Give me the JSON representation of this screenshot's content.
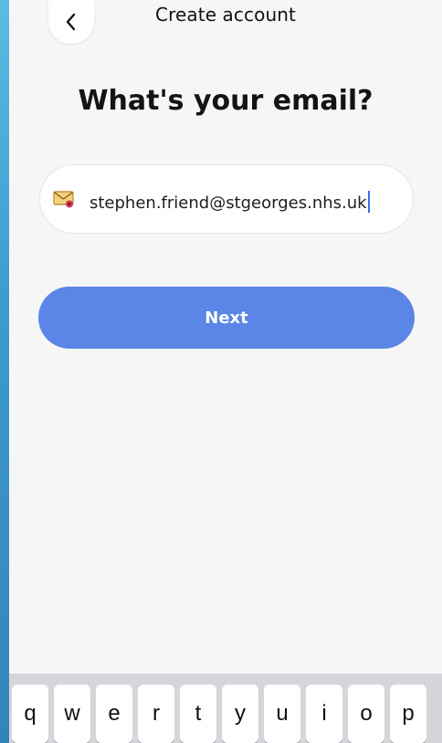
{
  "header": {
    "title": "Create account",
    "back_icon": "chevron-left-icon"
  },
  "main": {
    "headline": "What's your email?",
    "email_field": {
      "value": "stephen.friend@stgeorges.nhs.uk",
      "icon": "envelope-icon"
    },
    "next_button": {
      "label": "Next"
    }
  },
  "keyboard": {
    "row1": [
      "q",
      "w",
      "e",
      "r",
      "t",
      "y",
      "u",
      "i",
      "o",
      "p"
    ]
  },
  "colors": {
    "primary_button": "#5b85e6",
    "caret": "#3b6fe6",
    "background": "#f6f6f6"
  }
}
